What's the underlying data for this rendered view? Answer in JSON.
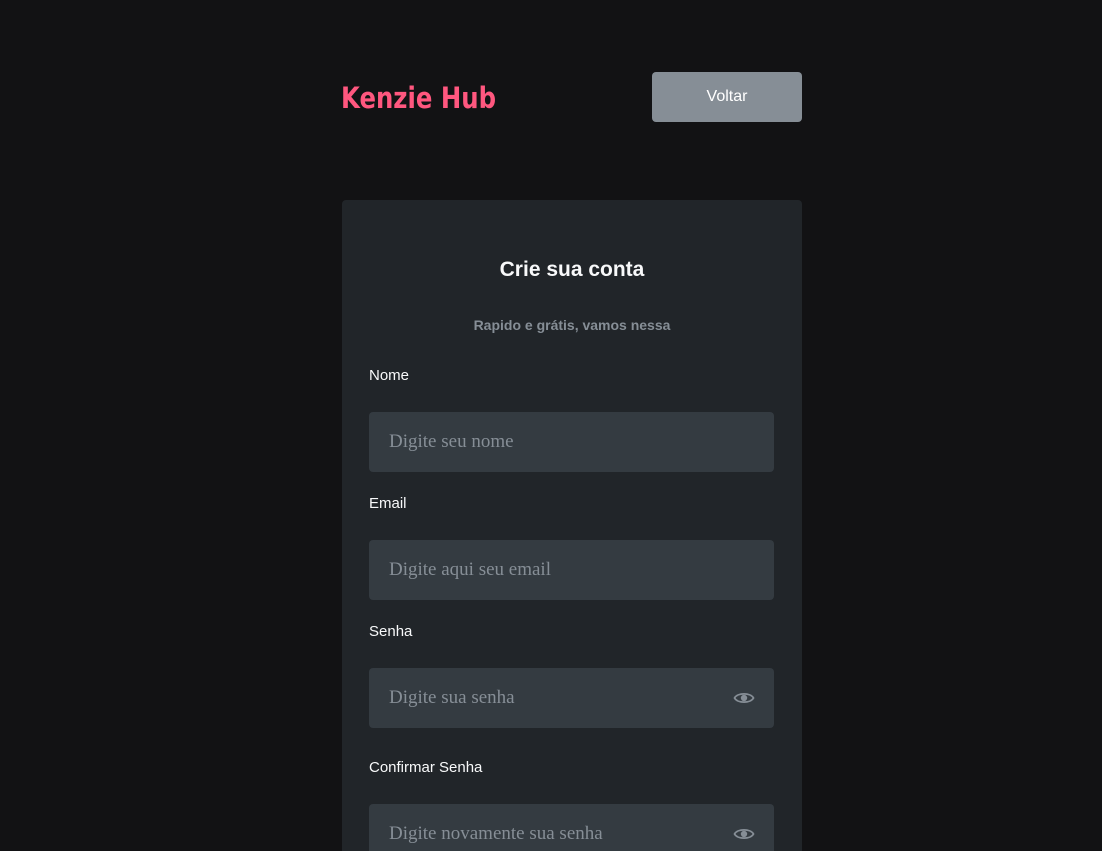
{
  "header": {
    "brand": "Kenzie Hub",
    "back_label": "Voltar"
  },
  "form": {
    "title": "Crie sua conta",
    "subtitle": "Rapido e grátis, vamos nessa",
    "fields": [
      {
        "label": "Nome",
        "placeholder": "Digite seu nome",
        "value": ""
      },
      {
        "label": "Email",
        "placeholder": "Digite aqui seu email",
        "value": ""
      },
      {
        "label": "Senha",
        "placeholder": "Digite sua senha",
        "value": "",
        "icon": "eye-icon"
      },
      {
        "label": "Confirmar Senha",
        "placeholder": "Digite novamente sua senha",
        "value": "",
        "icon": "eye-icon"
      }
    ]
  },
  "colors": {
    "background": "#121214",
    "brand": "#ff577f",
    "card": "#212529",
    "input": "#343b41",
    "button": "#868e96",
    "muted_text": "#868e96",
    "text": "#f8f9fa"
  }
}
